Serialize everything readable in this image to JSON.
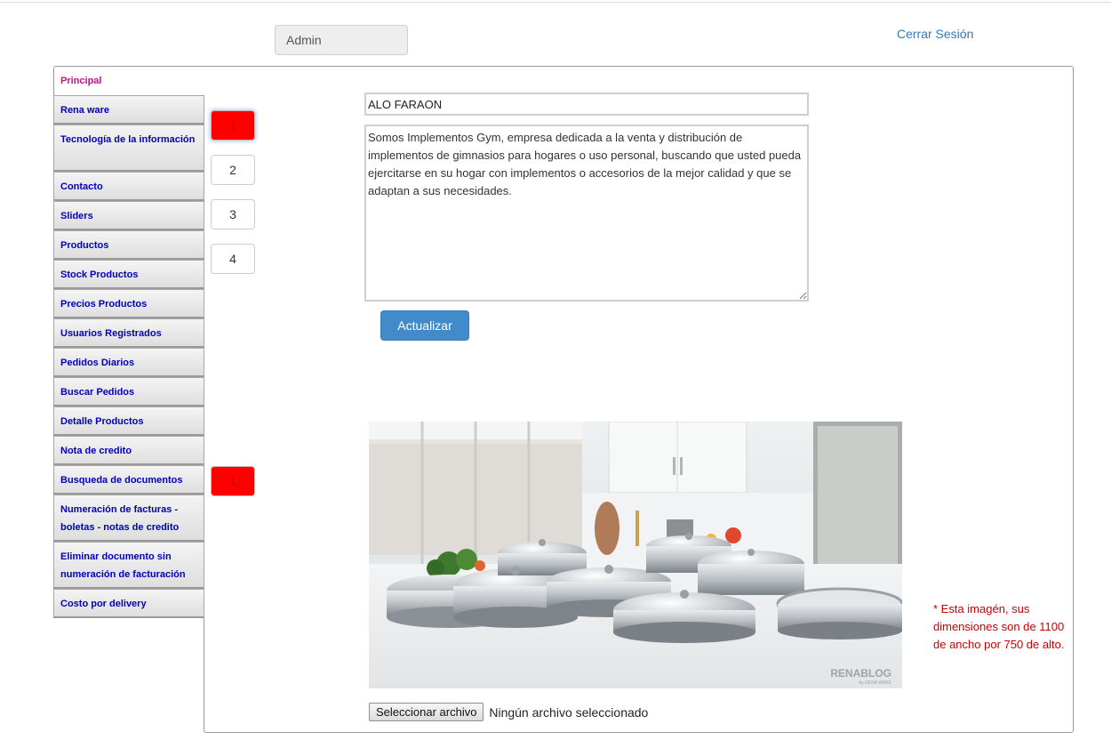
{
  "header": {
    "user_field": "Admin",
    "logout_label": "Cerrar Sesión"
  },
  "sidebar": {
    "active_tab": "Principal",
    "items": [
      {
        "label": "Rena ware"
      },
      {
        "label": "Tecnología de la información"
      },
      {
        "label": "Contacto"
      },
      {
        "label": "Sliders"
      },
      {
        "label": "Productos"
      },
      {
        "label": "Stock Productos"
      },
      {
        "label": "Precios Productos"
      },
      {
        "label": "Usuarios Registrados"
      },
      {
        "label": "Pedidos Diarios"
      },
      {
        "label": "Buscar Pedidos"
      },
      {
        "label": "Detalle Productos"
      },
      {
        "label": "Nota de credito"
      },
      {
        "label": "Busqueda de documentos"
      },
      {
        "label": "Numeración de facturas - boletas - notas de credito"
      },
      {
        "label": "Eliminar documento sin numeración de facturación"
      },
      {
        "label": "Costo por delivery"
      }
    ]
  },
  "pager": {
    "buttons": [
      "1",
      "2",
      "3",
      "4"
    ],
    "second_group": [
      "1"
    ]
  },
  "content": {
    "title_value": "ALO FARAON",
    "description": "Somos Implementos Gym, empresa dedicada a la venta y distribución de implementos de gimnasios para hogares o uso personal, buscando que usted pueda ejercitarse en su hogar con implementos o accesorios de la mejor calidad y que se adaptan a sus necesidades.",
    "update_label": "Actualizar",
    "image_watermark": "RENABLOG",
    "image_watermark_sub": "by RENA WARE",
    "image_note": "* Esta imagén, sus dimensiones son de 1100 de ancho por 750 de alto.",
    "file_button": "Seleccionar archivo",
    "file_status": "Ningún archivo seleccionado"
  },
  "colors": {
    "accent": "#428bca",
    "active_page": "#ff0000",
    "sidebar_text": "#0000c0",
    "active_tab_text": "#c0138d",
    "note_text": "#cc0000"
  }
}
